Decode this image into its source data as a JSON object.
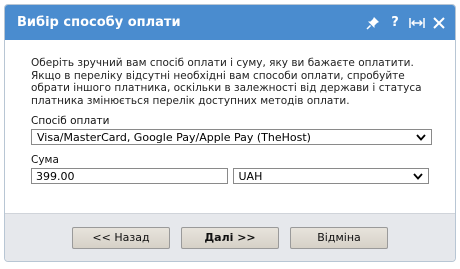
{
  "dialog": {
    "title": "Вибір способу оплати",
    "icons": [
      "pin-icon",
      "help-icon",
      "resize-icon",
      "close-icon"
    ],
    "help_glyph": "?"
  },
  "description": "Оберіть зручний вам спосіб оплати і суму, яку ви бажаєте оплатити. Якщо в переліку відсутні необхідні вам способи оплати, спробуйте обрати іншого платника, оскільки в залежності від держави і статуса платника змінюється перелік доступних методів оплати.",
  "payment_method": {
    "label": "Спосіб оплати",
    "selected": "Visa/MasterCard, Google Pay/Apple Pay (TheHost)"
  },
  "amount": {
    "label": "Сума",
    "value": "399.00",
    "currency": "UAH"
  },
  "buttons": {
    "back": "<< Назад",
    "next": "Далі >>",
    "cancel": "Відміна"
  },
  "colors": {
    "titlebar": "#4a8ccf",
    "footer": "#e6e8ec"
  }
}
